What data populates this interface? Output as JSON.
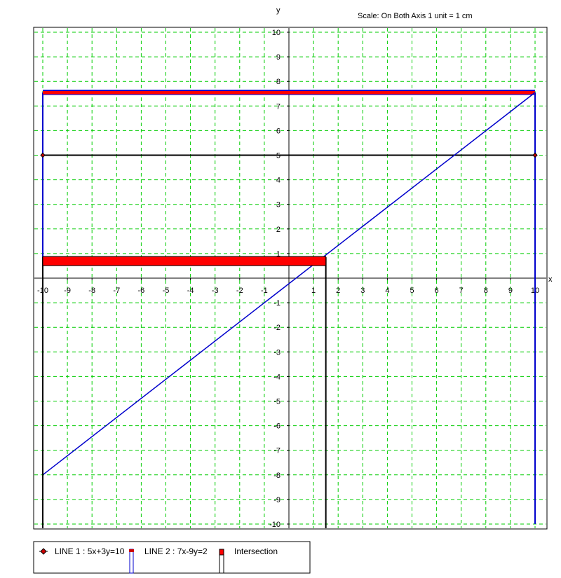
{
  "chart_data": {
    "type": "line",
    "title": "",
    "scale_note": "Scale: On Both Axis 1 unit = 1 cm",
    "xlabel": "x",
    "ylabel": "y",
    "xlim": [
      -10,
      10
    ],
    "ylim": [
      -10,
      10
    ],
    "grid": true,
    "grid_color": "#00cc00",
    "x_ticks": [
      "-10",
      "-9",
      "-8",
      "-7",
      "-6",
      "-5",
      "-4",
      "-3",
      "-2",
      "-1",
      "1",
      "2",
      "3",
      "4",
      "5",
      "6",
      "7",
      "8",
      "9",
      "10"
    ],
    "y_ticks": [
      "10",
      "9",
      "8",
      "7",
      "6",
      "5",
      "4",
      "3",
      "2",
      "1",
      "-1",
      "-2",
      "-3",
      "-4",
      "-5",
      "-6",
      "-7",
      "-8",
      "-9",
      "-10"
    ],
    "series": [
      {
        "name": "LINE 1 : 5x+3y=10",
        "color": "#000000",
        "marker": "diamond",
        "points": [
          [
            -10,
            5
          ],
          [
            10,
            5
          ]
        ]
      },
      {
        "name": "LINE 2 : 7x-9y=2",
        "color": "#0000cc",
        "marker": "none",
        "points": [
          [
            -10,
            -8
          ],
          [
            10,
            7.55
          ]
        ]
      }
    ],
    "intersection": {
      "name": "Intersection",
      "color": "#ff0000",
      "x": 1.5,
      "y": 0.85
    },
    "blue_rect": {
      "x1": -10,
      "y1": 7.55,
      "x2": 10,
      "y2": -10
    },
    "legend_position": "bottom-left"
  }
}
